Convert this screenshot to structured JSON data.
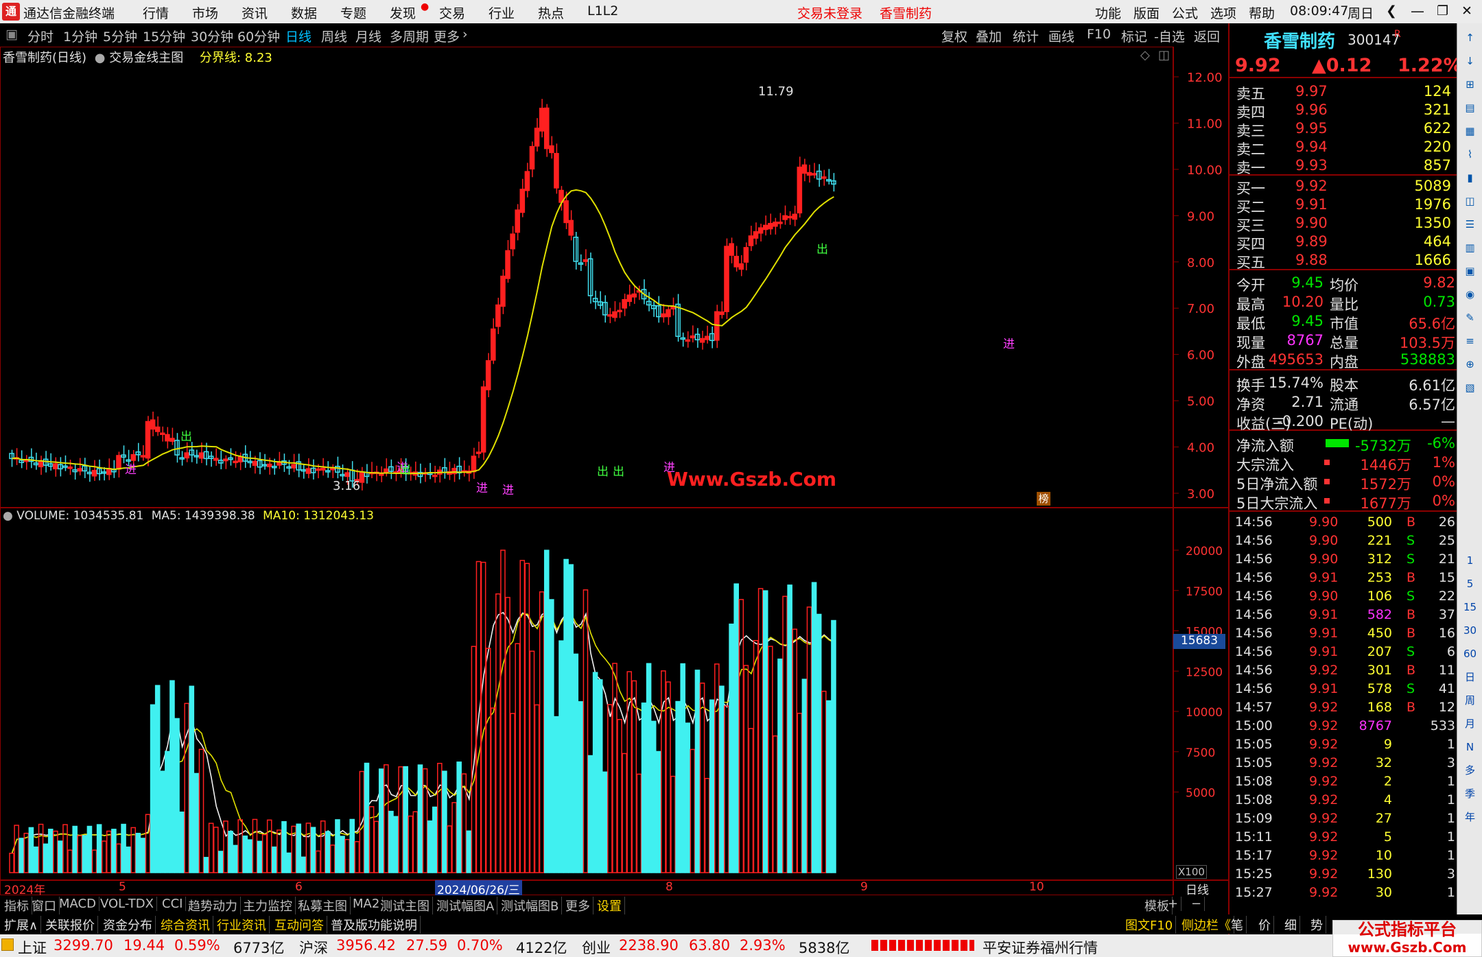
{
  "app": {
    "title": "通达信金融终端",
    "menus": [
      "行情",
      "市场",
      "资讯",
      "数据",
      "专题",
      "发现",
      "交易",
      "行业",
      "热点",
      "L1L2"
    ],
    "login": "交易未登录",
    "stock_name_top": "香雪制药",
    "right_menus": [
      "功能",
      "版面",
      "公式",
      "选项",
      "帮助"
    ],
    "time": "08:09:47",
    "weekday": "周日"
  },
  "toolbar": {
    "periods": [
      "分时",
      "1分钟",
      "5分钟",
      "15分钟",
      "30分钟",
      "60分钟",
      "日线",
      "周线",
      "月线",
      "多周期",
      "更多"
    ],
    "active": "日线",
    "right": [
      "复权",
      "叠加",
      "统计",
      "画线",
      "F10",
      "标记",
      "-自选",
      "返回"
    ]
  },
  "chart": {
    "title": "香雪制药(日线)",
    "indicator": "交易金线主图",
    "boundary_label": "分界线:",
    "boundary_value": "8.23",
    "high_label": "11.79",
    "low_label": "3.16",
    "watermark": "Www.Gszb.Com",
    "rank_badge": "榜",
    "price_ticks": [
      "12.00",
      "11.00",
      "10.00",
      "9.00",
      "8.00",
      "7.00",
      "6.00",
      "5.00",
      "4.00",
      "3.00"
    ],
    "buy_marks": [
      "进",
      "进",
      "进",
      "进",
      "进",
      "进"
    ],
    "sell_marks": [
      "出",
      "出",
      "出",
      "出",
      "出"
    ]
  },
  "volume": {
    "label": "VOLUME:",
    "value": "1034535.81",
    "ma5_label": "MA5:",
    "ma5": "1439398.38",
    "ma10_label": "MA10:",
    "ma10": "1312043.13",
    "ticks": [
      "20000",
      "17500",
      "15000",
      "12500",
      "10000",
      "7500",
      "5000"
    ],
    "current_badge": "15683",
    "unit": "X100"
  },
  "x_axis": {
    "labels": [
      "2024年",
      "5",
      "6",
      "2024/06/26/三",
      "8",
      "9",
      "10"
    ],
    "period": "日线"
  },
  "chart_data": {
    "type": "candlestick",
    "title": "香雪制药(日线)",
    "ylim": [
      3.0,
      12.0
    ],
    "volume_ylim": [
      0,
      22000
    ],
    "dates": [
      "2024-04",
      "2024-05",
      "2024-06",
      "2024-06-26",
      "2024-08",
      "2024-09",
      "2024-10"
    ],
    "high": 11.79,
    "low": 3.16,
    "boundary": 8.23,
    "last_volume": 1034535.81,
    "ma5": 1439398.38,
    "ma10": 1312043.13
  },
  "quote": {
    "name": "香雪制药",
    "code": "300147",
    "badge": "R",
    "price": "9.92",
    "change": "▲0.12",
    "pct": "1.22%",
    "asks": [
      {
        "label": "卖五",
        "price": "9.97",
        "vol": "124"
      },
      {
        "label": "卖四",
        "price": "9.96",
        "vol": "321"
      },
      {
        "label": "卖三",
        "price": "9.95",
        "vol": "622"
      },
      {
        "label": "卖二",
        "price": "9.94",
        "vol": "220"
      },
      {
        "label": "卖一",
        "price": "9.93",
        "vol": "857"
      }
    ],
    "bids": [
      {
        "label": "买一",
        "price": "9.92",
        "vol": "5089"
      },
      {
        "label": "买二",
        "price": "9.91",
        "vol": "1976"
      },
      {
        "label": "买三",
        "price": "9.90",
        "vol": "1350"
      },
      {
        "label": "买四",
        "price": "9.89",
        "vol": "464"
      },
      {
        "label": "买五",
        "price": "9.88",
        "vol": "1666"
      }
    ],
    "stats": [
      {
        "l1": "今开",
        "v1": "9.45",
        "l2": "均价",
        "v2": "9.82"
      },
      {
        "l1": "最高",
        "v1": "10.20",
        "l2": "量比",
        "v2": "0.73"
      },
      {
        "l1": "最低",
        "v1": "9.45",
        "l2": "市值",
        "v2": "65.6亿"
      },
      {
        "l1": "现量",
        "v1": "8767",
        "l2": "总量",
        "v2": "103.5万"
      },
      {
        "l1": "外盘",
        "v1": "495653",
        "l2": "内盘",
        "v2": "538883"
      }
    ],
    "stats2": [
      {
        "l1": "换手",
        "v1": "15.74%",
        "l2": "股本",
        "v2": "6.61亿"
      },
      {
        "l1": "净资",
        "v1": "2.71",
        "l2": "流通",
        "v2": "6.57亿"
      },
      {
        "l1": "收益(三)",
        "v1": "-0.200",
        "l2": "PE(动)",
        "v2": "—"
      }
    ],
    "flows": [
      {
        "label": "净流入额",
        "value": "-5732万",
        "pct": "-6%"
      },
      {
        "label": "大宗流入",
        "value": "1446万",
        "pct": "1%"
      },
      {
        "label": "5日净流入额",
        "value": "1572万",
        "pct": "0%"
      },
      {
        "label": "5日大宗流入",
        "value": "1677万",
        "pct": "0%"
      }
    ]
  },
  "ticks": [
    [
      "14:56",
      "9.90",
      "500",
      "B",
      "26"
    ],
    [
      "14:56",
      "9.90",
      "221",
      "S",
      "25"
    ],
    [
      "14:56",
      "9.90",
      "312",
      "S",
      "21"
    ],
    [
      "14:56",
      "9.91",
      "253",
      "B",
      "15"
    ],
    [
      "14:56",
      "9.90",
      "106",
      "S",
      "22"
    ],
    [
      "14:56",
      "9.91",
      "582",
      "B",
      "37"
    ],
    [
      "14:56",
      "9.91",
      "450",
      "B",
      "16"
    ],
    [
      "14:56",
      "9.91",
      "207",
      "S",
      "6"
    ],
    [
      "14:56",
      "9.92",
      "301",
      "B",
      "11"
    ],
    [
      "14:56",
      "9.91",
      "578",
      "S",
      "41"
    ],
    [
      "14:57",
      "9.92",
      "168",
      "B",
      "12"
    ],
    [
      "15:00",
      "9.92",
      "8767",
      "",
      "533"
    ],
    [
      "15:05",
      "9.92",
      "9",
      "",
      "1"
    ],
    [
      "15:05",
      "9.92",
      "32",
      "",
      "3"
    ],
    [
      "15:08",
      "9.92",
      "2",
      "",
      "1"
    ],
    [
      "15:08",
      "9.92",
      "4",
      "",
      "1"
    ],
    [
      "15:09",
      "9.92",
      "27",
      "",
      "1"
    ],
    [
      "15:11",
      "9.92",
      "5",
      "",
      "1"
    ],
    [
      "15:17",
      "9.92",
      "10",
      "",
      "1"
    ],
    [
      "15:25",
      "9.92",
      "130",
      "",
      "3"
    ],
    [
      "15:27",
      "9.92",
      "30",
      "",
      "1"
    ]
  ],
  "bottom_tabs": [
    "指标",
    "窗口",
    "MACD",
    "VOL-TDX",
    "CCI",
    "趋势动力",
    "主力监控",
    "私募主图",
    "MA2",
    "测试主图",
    "测试幅图A",
    "测试幅图B",
    "更多",
    "设置"
  ],
  "bottom_right": [
    "模板",
    "+",
    "−"
  ],
  "bottom2": [
    "扩展∧",
    "关联报价",
    "资金分布",
    "综合资讯",
    "行业资讯",
    "互动问答",
    "普及版功能说明"
  ],
  "bottom2_right": [
    "图文F10",
    "侧边栏《",
    "笔",
    "价",
    "细",
    "势"
  ],
  "status": {
    "sh_label": "上证",
    "sh": "3299.70",
    "sh_chg": "19.44",
    "sh_pct": "0.59%",
    "sh_amt": "6773亿",
    "hs_label": "沪深",
    "hs": "3956.42",
    "hs_chg": "27.59",
    "hs_pct": "0.70%",
    "hs_amt": "4122亿",
    "cy_label": "创业",
    "cy": "2238.90",
    "cy_chg": "63.80",
    "cy_pct": "2.93%",
    "cy_amt": "5838亿",
    "broker": "平安证券福州行情"
  },
  "watermark2": {
    "line1": "公式指标平台",
    "line2": "www.Gszb.Com"
  },
  "vbar_labels": [
    "1",
    "5",
    "15",
    "30",
    "60",
    "日",
    "周",
    "月",
    "N",
    "多",
    "季",
    "年"
  ]
}
